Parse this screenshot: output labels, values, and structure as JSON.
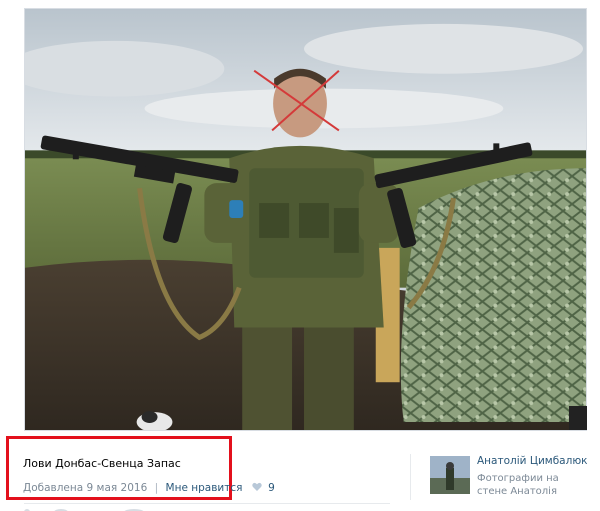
{
  "photo": {
    "icon": "photo-image"
  },
  "caption": {
    "text": "Лови Донбас-Свенца Запас",
    "date": "Добавлена 9 мая 2016",
    "separator": "|",
    "like_label": "Мне нравится",
    "like_count": "9",
    "highlight_color": "#e3101c"
  },
  "author": {
    "name": "Анатолій Цимбалюк",
    "subtitle": "Фотографии на стене Анатолія"
  },
  "colors": {
    "link": "#2b587a",
    "muted": "#7c8996"
  }
}
